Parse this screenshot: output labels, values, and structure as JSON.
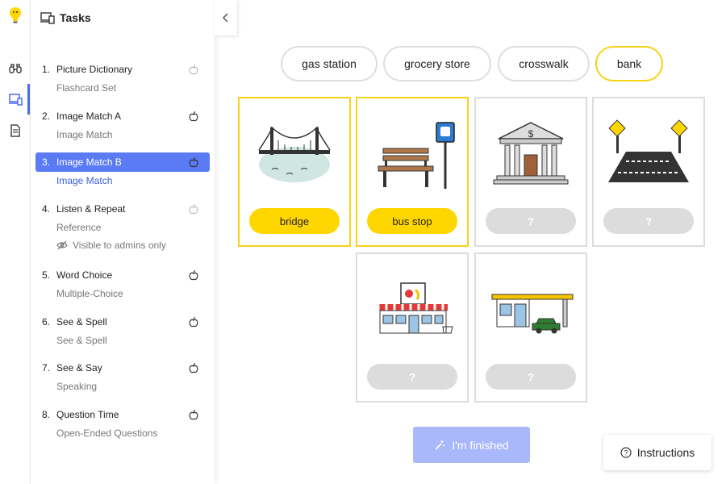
{
  "sidebar": {
    "title": "Tasks",
    "tasks": [
      {
        "num": "1.",
        "title": "Picture Dictionary",
        "subtitle": "Flashcard Set",
        "active": false
      },
      {
        "num": "2.",
        "title": "Image Match A",
        "subtitle": "Image Match",
        "active": false
      },
      {
        "num": "3.",
        "title": "Image Match B",
        "subtitle": "Image Match",
        "active": true
      },
      {
        "num": "4.",
        "title": "Listen & Repeat",
        "subtitle": "Reference",
        "note": "Visible to admins only",
        "active": false
      },
      {
        "num": "5.",
        "title": "Word Choice",
        "subtitle": "Multiple-Choice",
        "active": false
      },
      {
        "num": "6.",
        "title": "See & Spell",
        "subtitle": "See & Spell",
        "active": false
      },
      {
        "num": "7.",
        "title": "See & Say",
        "subtitle": "Speaking",
        "active": false
      },
      {
        "num": "8.",
        "title": "Question Time",
        "subtitle": "Open-Ended Questions",
        "active": false
      }
    ]
  },
  "word_bank": [
    "gas station",
    "grocery store",
    "crosswalk",
    "bank"
  ],
  "cards": [
    {
      "image": "bridge",
      "label": "bridge"
    },
    {
      "image": "bus-stop",
      "label": "bus stop"
    },
    {
      "image": "bank",
      "label": "?"
    },
    {
      "image": "crosswalk",
      "label": "?"
    },
    {
      "image": "grocery-store",
      "label": "?"
    },
    {
      "image": "gas-station",
      "label": "?"
    }
  ],
  "buttons": {
    "finish": "I'm finished",
    "instructions": "Instructions"
  },
  "colors": {
    "accent": "#5b7bf5",
    "highlight": "#ffd600",
    "finish_disabled": "#a9b7fb"
  }
}
